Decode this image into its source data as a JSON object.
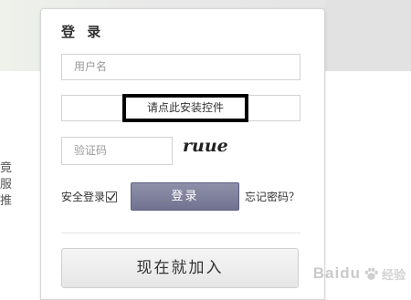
{
  "left_edge": {
    "lines": [
      "竟",
      "服",
      "推"
    ]
  },
  "login": {
    "title": "登 录",
    "username_placeholder": "用户名",
    "plugin_prompt": "请点此安装控件",
    "captcha_placeholder": "验证码",
    "captcha_image_text": "ruue",
    "secure_login_label": "安全登录",
    "secure_login_checked": true,
    "login_button_label": "登录",
    "forgot_password_label": "忘记密码？",
    "join_button_label": "现在就加入"
  },
  "watermark": {
    "brand": "Baidu",
    "sub": "经验"
  },
  "colors": {
    "login_button": "#7d7e9a",
    "highlight_border": "#000000"
  }
}
